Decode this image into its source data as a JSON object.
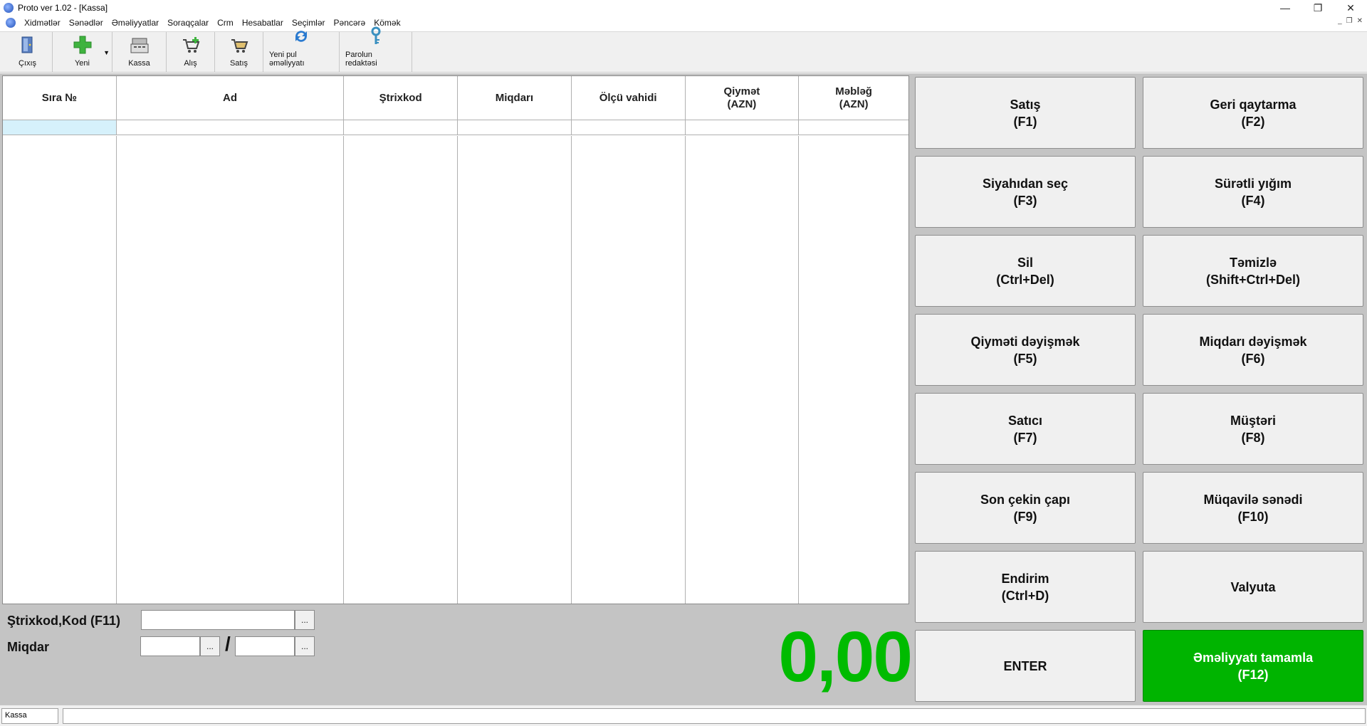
{
  "window": {
    "title": "Proto ver 1.02 - [Kassa]",
    "minimize": "—",
    "maximize": "❐",
    "close": "✕"
  },
  "menu": {
    "items": [
      "Xidmətlər",
      "Sənədlər",
      "Əməliyyatlar",
      "Soraqçalar",
      "Crm",
      "Hesabatlar",
      "Seçimlər",
      "Pəncərə",
      "Kömək"
    ],
    "mdi": [
      "_",
      "❐",
      "✕"
    ]
  },
  "toolbar": {
    "exit": "Çıxış",
    "new": "Yeni",
    "kassa": "Kassa",
    "purchase": "Alış",
    "sale": "Satış",
    "new_money": "Yeni pul əməliyyatı",
    "password": "Parolun redaktəsi"
  },
  "grid": {
    "columns": [
      "Sıra №",
      "Ad",
      "Ştrixkod",
      "Miqdarı",
      "Ölçü vahidi",
      "Qiymət\n(AZN)",
      "Məbləğ\n(AZN)"
    ]
  },
  "inputs": {
    "barcode_label": "Ştrixkod,Kod (F11)",
    "quantity_label": "Miqdar",
    "ellipsis": "...",
    "slash": "/"
  },
  "total": "0,00",
  "buttons": [
    {
      "line1": "Satış",
      "line2": "(F1)"
    },
    {
      "line1": "Geri qaytarma",
      "line2": "(F2)"
    },
    {
      "line1": "Siyahıdan seç",
      "line2": "(F3)"
    },
    {
      "line1": "Sürətli yığım",
      "line2": "(F4)"
    },
    {
      "line1": "Sil",
      "line2": "(Ctrl+Del)"
    },
    {
      "line1": "Təmizlə",
      "line2": "(Shift+Ctrl+Del)"
    },
    {
      "line1": "Qiyməti dəyişmək",
      "line2": "(F5)"
    },
    {
      "line1": "Miqdarı dəyişmək",
      "line2": "(F6)"
    },
    {
      "line1": "Satıcı",
      "line2": "(F7)"
    },
    {
      "line1": "Müştəri",
      "line2": "(F8)"
    },
    {
      "line1": "Son çekin çapı",
      "line2": "(F9)"
    },
    {
      "line1": "Müqavilə sənədi",
      "line2": "(F10)"
    },
    {
      "line1": "Endirim",
      "line2": "(Ctrl+D)"
    },
    {
      "line1": "Valyuta",
      "line2": ""
    },
    {
      "line1": "ENTER",
      "line2": ""
    },
    {
      "line1": "Əməliyyatı tamamla",
      "line2": "(F12)"
    }
  ],
  "status": {
    "cell1": "Kassa"
  },
  "colors": {
    "accent_green": "#00b400",
    "total_green": "#00bb00",
    "panel_gray": "#c4c4c4"
  }
}
